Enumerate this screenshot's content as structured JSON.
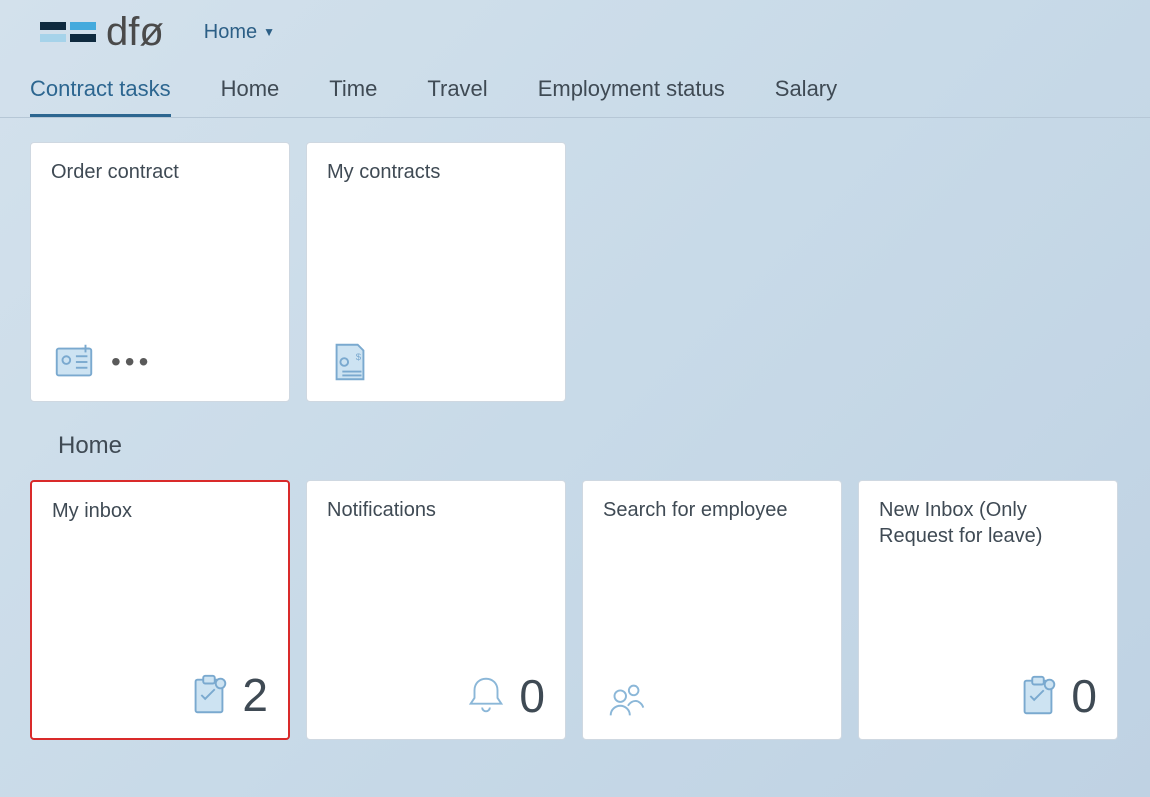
{
  "header": {
    "brand": "dfø",
    "menu_label": "Home"
  },
  "nav": {
    "items": [
      {
        "label": "Contract tasks",
        "active": true
      },
      {
        "label": "Home"
      },
      {
        "label": "Time"
      },
      {
        "label": "Travel"
      },
      {
        "label": "Employment status"
      },
      {
        "label": "Salary"
      }
    ]
  },
  "sections": [
    {
      "tiles": [
        {
          "title": "Order contract",
          "icon": "id-card-plus",
          "ellipsis": true
        },
        {
          "title": "My contracts",
          "icon": "money-doc"
        }
      ]
    },
    {
      "title": "Home",
      "tiles": [
        {
          "title": "My inbox",
          "icon": "clipboard",
          "count": "2",
          "highlight": true
        },
        {
          "title": "Notifications",
          "icon": "bell",
          "count": "0"
        },
        {
          "title": "Search for employee",
          "icon": "people"
        },
        {
          "title": "New Inbox (Only Request for leave)",
          "icon": "clipboard",
          "count": "0"
        }
      ]
    }
  ]
}
